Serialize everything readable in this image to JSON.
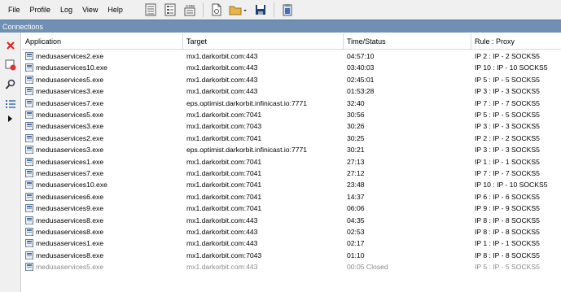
{
  "menu": [
    {
      "label": "File"
    },
    {
      "label": "Profile"
    },
    {
      "label": "Log"
    },
    {
      "label": "View"
    },
    {
      "label": "Help"
    }
  ],
  "toolbar": [
    {
      "icon": "proxies-list-icon"
    },
    {
      "icon": "rules-list-icon"
    },
    {
      "icon": "dns-icon",
      "text": ".COM"
    },
    {
      "icon": "new-profile-icon"
    },
    {
      "icon": "open-folder-icon"
    },
    {
      "icon": "save-icon"
    },
    {
      "icon": "clipboard-icon"
    }
  ],
  "window": {
    "title": "Connections"
  },
  "left_toolbar": [
    {
      "icon": "close-connection-icon"
    },
    {
      "icon": "block-icon"
    },
    {
      "icon": "search-icon"
    },
    {
      "icon": "list-icon"
    },
    {
      "icon": "expand-arrow-icon"
    }
  ],
  "columns": [
    "Application",
    "Target",
    "Time/Status",
    "Rule : Proxy"
  ],
  "rows": [
    {
      "app": "medusaservices2.exe",
      "target": "mx1.darkorbit.com:443",
      "time": "04:57:10",
      "rule": "IP 2 : IP - 2 SOCKS5"
    },
    {
      "app": "medusaservices10.exe",
      "target": "mx1.darkorbit.com:443",
      "time": "03:40:03",
      "rule": "IP 10 : IP - 10 SOCKS5"
    },
    {
      "app": "medusaservices5.exe",
      "target": "mx1.darkorbit.com:443",
      "time": "02:45:01",
      "rule": "IP 5 : IP - 5 SOCKS5"
    },
    {
      "app": "medusaservices3.exe",
      "target": "mx1.darkorbit.com:443",
      "time": "01:53:28",
      "rule": "IP 3 : IP - 3 SOCKS5"
    },
    {
      "app": "medusaservices7.exe",
      "target": "eps.optimist.darkorbit.infinicast.io:7771",
      "time": "32:40",
      "rule": "IP 7 : IP - 7 SOCKS5"
    },
    {
      "app": "medusaservices5.exe",
      "target": "mx1.darkorbit.com:7041",
      "time": "30:56",
      "rule": "IP 5 : IP - 5 SOCKS5"
    },
    {
      "app": "medusaservices3.exe",
      "target": "mx1.darkorbit.com:7043",
      "time": "30:26",
      "rule": "IP 3 : IP - 3 SOCKS5"
    },
    {
      "app": "medusaservices2.exe",
      "target": "mx1.darkorbit.com:7041",
      "time": "30:25",
      "rule": "IP 2 : IP - 2 SOCKS5"
    },
    {
      "app": "medusaservices3.exe",
      "target": "eps.optimist.darkorbit.infinicast.io:7771",
      "time": "30:21",
      "rule": "IP 3 : IP - 3 SOCKS5"
    },
    {
      "app": "medusaservices1.exe",
      "target": "mx1.darkorbit.com:7041",
      "time": "27:13",
      "rule": "IP 1 : IP - 1 SOCKS5"
    },
    {
      "app": "medusaservices7.exe",
      "target": "mx1.darkorbit.com:7041",
      "time": "27:12",
      "rule": "IP 7 : IP - 7 SOCKS5"
    },
    {
      "app": "medusaservices10.exe",
      "target": "mx1.darkorbit.com:7041",
      "time": "23:48",
      "rule": "IP 10 : IP - 10 SOCKS5"
    },
    {
      "app": "medusaservices6.exe",
      "target": "mx1.darkorbit.com:7041",
      "time": "14:37",
      "rule": "IP 6 : IP - 6 SOCKS5"
    },
    {
      "app": "medusaservices9.exe",
      "target": "mx1.darkorbit.com:7041",
      "time": "06:06",
      "rule": "IP 9 : IP - 9 SOCKS5"
    },
    {
      "app": "medusaservices8.exe",
      "target": "mx1.darkorbit.com:443",
      "time": "04:35",
      "rule": "IP 8 : IP - 8 SOCKS5"
    },
    {
      "app": "medusaservices8.exe",
      "target": "mx1.darkorbit.com:443",
      "time": "02:53",
      "rule": "IP 8 : IP - 8 SOCKS5"
    },
    {
      "app": "medusaservices1.exe",
      "target": "mx1.darkorbit.com:443",
      "time": "02:17",
      "rule": "IP 1 : IP - 1 SOCKS5"
    },
    {
      "app": "medusaservices8.exe",
      "target": "mx1.darkorbit.com:7043",
      "time": "01:10",
      "rule": "IP 8 : IP - 8 SOCKS5"
    },
    {
      "app": "medusaservices5.exe",
      "target": "mx1.darkorbit.com:443",
      "time": "00:05 Closed",
      "rule": "IP 5 : IP - 5 SOCKS5",
      "closed": true
    }
  ],
  "colors": {
    "titlebar": "#6f8fb4",
    "toolbar_bg": "#f0f0f0",
    "closed_text": "#8a8a8a"
  }
}
